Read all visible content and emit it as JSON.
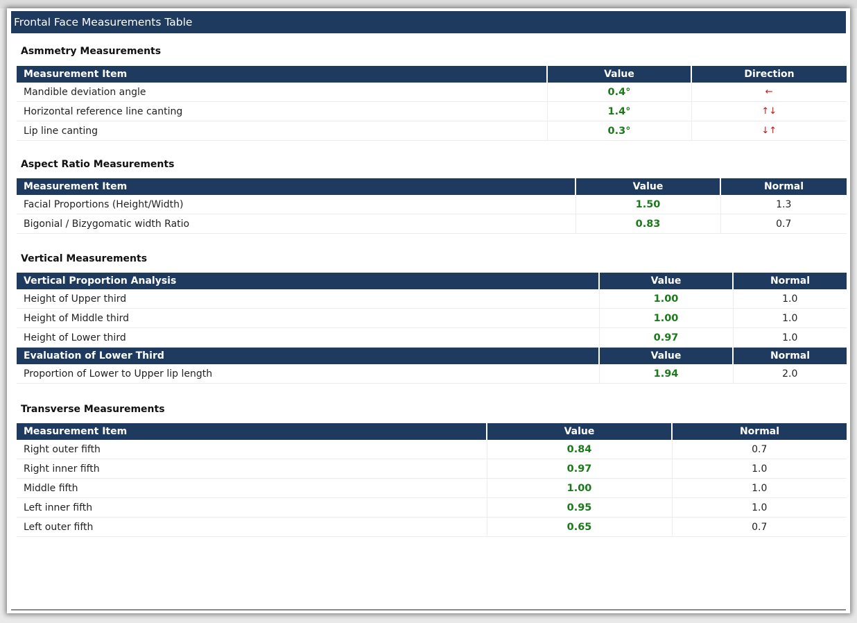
{
  "title": "Frontal Face Measurements Table",
  "asymmetry": {
    "section": "Asmmetry Measurements",
    "headers": [
      "Measurement Item",
      "Value",
      "Direction"
    ],
    "rows": [
      {
        "item": "Mandible deviation angle",
        "value": "0.4°",
        "direction": "←"
      },
      {
        "item": "Horizontal reference line canting",
        "value": "1.4°",
        "direction": "↑↓"
      },
      {
        "item": "Lip line canting",
        "value": "0.3°",
        "direction": "↓↑"
      }
    ]
  },
  "aspect": {
    "section": "Aspect Ratio Measurements",
    "headers": [
      "Measurement Item",
      "Value",
      "Normal"
    ],
    "rows": [
      {
        "item": "Facial Proportions (Height/Width)",
        "value": "1.50",
        "normal": "1.3"
      },
      {
        "item": "Bigonial / Bizygomatic width Ratio",
        "value": "0.83",
        "normal": "0.7"
      }
    ]
  },
  "vertical": {
    "section": "Vertical Measurements",
    "headers": [
      "Vertical Proportion Analysis",
      "Value",
      "Normal"
    ],
    "rows": [
      {
        "item": "Height of Upper third",
        "value": "1.00",
        "normal": "1.0"
      },
      {
        "item": "Height of Middle third",
        "value": "1.00",
        "normal": "1.0"
      },
      {
        "item": "Height of Lower third",
        "value": "0.97",
        "normal": "1.0"
      }
    ],
    "headers2": [
      "Evaluation of Lower Third",
      "Value",
      "Normal"
    ],
    "rows2": [
      {
        "item": "Proportion of Lower to Upper lip length",
        "value": "1.94",
        "normal": "2.0"
      }
    ]
  },
  "transverse": {
    "section": "Transverse Measurements",
    "headers": [
      "Measurement Item",
      "Value",
      "Normal"
    ],
    "rows": [
      {
        "item": "Right outer fifth",
        "value": "0.84",
        "normal": "0.7"
      },
      {
        "item": "Right inner fifth",
        "value": "0.97",
        "normal": "1.0"
      },
      {
        "item": "Middle fifth",
        "value": "1.00",
        "normal": "1.0"
      },
      {
        "item": "Left inner fifth",
        "value": "0.95",
        "normal": "1.0"
      },
      {
        "item": "Left outer fifth",
        "value": "0.65",
        "normal": "0.7"
      }
    ]
  }
}
